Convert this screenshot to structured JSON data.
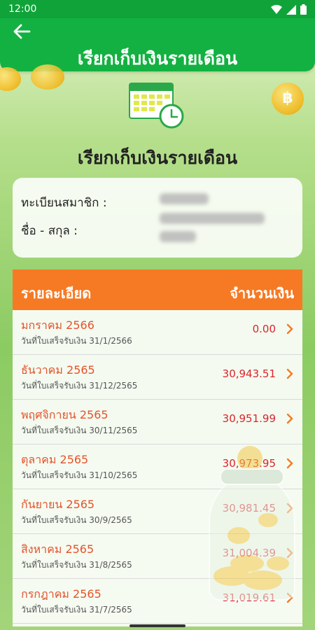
{
  "status": {
    "time": "12:00"
  },
  "header": {
    "title": "เรียกเก็บเงินรายเดือน"
  },
  "hero": {
    "title": "เรียกเก็บเงินรายเดือน"
  },
  "member": {
    "id_label": "ทะเบียนสมาชิก :",
    "name_label": "ชื่อ - สกุล :"
  },
  "list": {
    "col_detail": "รายละเอียด",
    "col_amount": "จำนวนเงิน",
    "rows": [
      {
        "month": "มกราคม 2566",
        "receipt": "วันที่ใบเสร็จรับเงิน 31/1/2566",
        "amount": "0.00"
      },
      {
        "month": "ธันวาคม 2565",
        "receipt": "วันที่ใบเสร็จรับเงิน 31/12/2565",
        "amount": "30,943.51"
      },
      {
        "month": "พฤศจิกายน 2565",
        "receipt": "วันที่ใบเสร็จรับเงิน 30/11/2565",
        "amount": "30,951.99"
      },
      {
        "month": "ตุลาคม 2565",
        "receipt": "วันที่ใบเสร็จรับเงิน 31/10/2565",
        "amount": "30,973.95"
      },
      {
        "month": "กันยายน 2565",
        "receipt": "วันที่ใบเสร็จรับเงิน 30/9/2565",
        "amount": "30,981.45"
      },
      {
        "month": "สิงหาคม 2565",
        "receipt": "วันที่ใบเสร็จรับเงิน 31/8/2565",
        "amount": "31,004.39"
      },
      {
        "month": "กรกฎาคม 2565",
        "receipt": "วันที่ใบเสร็จรับเงิน 31/7/2565",
        "amount": "31,019.61"
      }
    ]
  },
  "colors": {
    "primary_green": "#13b141",
    "header_orange": "#f57a23",
    "month_red": "#e4532b",
    "amount_red": "#d9262b"
  },
  "icons": [
    "back-arrow-icon",
    "wifi-icon",
    "signal-icon",
    "battery-icon",
    "calendar-clock-icon",
    "chevron-right-icon",
    "coin-icon",
    "coin-jar-icon"
  ]
}
